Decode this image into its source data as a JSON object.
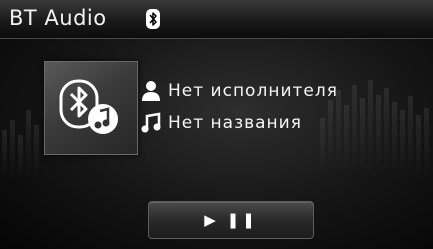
{
  "header": {
    "title": "BT Audio",
    "status_icon": "bluetooth-icon"
  },
  "album": {
    "icon": "bluetooth-music-icon"
  },
  "track": {
    "artist": "Нет исполнителя",
    "artist_icon": "person-icon",
    "title": "Нет названия",
    "title_icon": "music-note-icon"
  },
  "controls": {
    "play_pause_label": "▶ ❚❚",
    "play_pause_icon": "play-pause-icon"
  }
}
